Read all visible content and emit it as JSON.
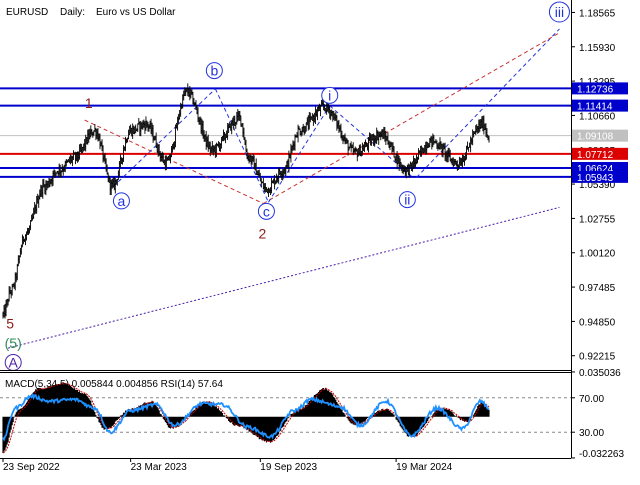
{
  "header": {
    "symbol": "EURUSD",
    "timeframe": "Daily:",
    "description": "Euro vs US Dollar"
  },
  "chart_data": [
    {
      "type": "line",
      "subtype": "candlestick-price",
      "x_ticks": [
        "23 Sep 2022",
        "23 Mar 2023",
        "19 Sep 2023",
        "19 Mar 2024"
      ],
      "y_ticks": [
        "1.18565",
        "1.15930",
        "1.13295",
        "1.10660",
        "1.08025",
        "1.05390",
        "1.02755",
        "1.00120",
        "0.97485",
        "0.94850",
        "0.92215"
      ],
      "ylim": [
        0.9112,
        1.1952
      ],
      "price_anchors": [
        {
          "t": 0,
          "p": 0.9535
        },
        {
          "t": 8,
          "p": 0.972
        },
        {
          "t": 22,
          "p": 1.015
        },
        {
          "t": 40,
          "p": 1.052
        },
        {
          "t": 55,
          "p": 1.065
        },
        {
          "t": 70,
          "p": 1.074
        },
        {
          "t": 90,
          "p": 1.095
        },
        {
          "t": 107,
          "p": 1.052
        },
        {
          "t": 125,
          "p": 1.095
        },
        {
          "t": 140,
          "p": 1.1
        },
        {
          "t": 160,
          "p": 1.07
        },
        {
          "t": 180,
          "p": 1.125
        },
        {
          "t": 205,
          "p": 1.08
        },
        {
          "t": 232,
          "p": 1.105
        },
        {
          "t": 240,
          "p": 1.075
        },
        {
          "t": 258,
          "p": 1.05
        },
        {
          "t": 275,
          "p": 1.065
        },
        {
          "t": 290,
          "p": 1.095
        },
        {
          "t": 315,
          "p": 1.113
        },
        {
          "t": 345,
          "p": 1.078
        },
        {
          "t": 370,
          "p": 1.092
        },
        {
          "t": 395,
          "p": 1.065
        },
        {
          "t": 420,
          "p": 1.087
        },
        {
          "t": 445,
          "p": 1.07
        },
        {
          "t": 470,
          "p": 1.1
        },
        {
          "t": 476,
          "p": 1.09
        }
      ],
      "horizontal_levels": [
        {
          "value": 1.12736,
          "label": "1.12736",
          "color": "#0000cc",
          "label_bg": "#0000cc"
        },
        {
          "value": 1.11414,
          "label": "1.11414",
          "color": "#0000cc",
          "label_bg": "#0000cc"
        },
        {
          "value": 1.09108,
          "label": "1.09108",
          "color": "#c0c0c0",
          "label_bg": "#c0c0c0"
        },
        {
          "value": 1.07712,
          "label": "1.07712",
          "color": "#dd0000",
          "label_bg": "#dd0000"
        },
        {
          "value": 1.06624,
          "label": "1.06624",
          "color": "#0000cc",
          "label_bg": "#0000cc"
        },
        {
          "value": 1.05943,
          "label": "1.05943",
          "color": "#0000cc",
          "label_bg": "#0000cc"
        }
      ],
      "trend_lines": [
        {
          "from": {
            "t": 5,
            "p": 0.928
          },
          "to": {
            "t": 545,
            "p": 1.036
          },
          "color": "#4b1fa8",
          "style": "dotted"
        },
        {
          "from": {
            "t": 405,
            "p": 1.059
          },
          "to": {
            "t": 545,
            "p": 1.173
          },
          "color": "#2233dd",
          "style": "dashed"
        },
        {
          "from": {
            "t": 255,
            "p": 1.039
          },
          "to": {
            "t": 545,
            "p": 1.17
          },
          "color": "#cc3333",
          "style": "dashed"
        },
        {
          "from": {
            "t": 80,
            "p": 1.103
          },
          "to": {
            "t": 255,
            "p": 1.039
          },
          "color": "#cc3333",
          "style": "dashed"
        },
        {
          "from": {
            "t": 108,
            "p": 1.052
          },
          "to": {
            "t": 208,
            "p": 1.127
          },
          "color": "#2233dd",
          "style": "dashed"
        },
        {
          "from": {
            "t": 208,
            "p": 1.127
          },
          "to": {
            "t": 260,
            "p": 1.04
          },
          "color": "#2233dd",
          "style": "dashed"
        },
        {
          "from": {
            "t": 260,
            "p": 1.04
          },
          "to": {
            "t": 320,
            "p": 1.114
          },
          "color": "#2233dd",
          "style": "dashed"
        },
        {
          "from": {
            "t": 320,
            "p": 1.114
          },
          "to": {
            "t": 400,
            "p": 1.06
          },
          "color": "#2233dd",
          "style": "dashed"
        }
      ],
      "wave_labels": [
        {
          "text": "1",
          "t": 84,
          "p": 1.116,
          "color": "#8b1a1a",
          "circled": false
        },
        {
          "text": "2",
          "t": 254,
          "p": 1.016,
          "color": "#8b1a1a",
          "circled": false
        },
        {
          "text": "5",
          "t": 7,
          "p": 0.947,
          "color": "#8b1a1a",
          "circled": false
        },
        {
          "text": "(5)",
          "t": 10,
          "p": 0.932,
          "color": "#2e8b57",
          "circled": false
        },
        {
          "text": "A",
          "t": 10,
          "p": 0.917,
          "color": "#4b1fa8",
          "circled": true
        },
        {
          "text": "a",
          "t": 116,
          "p": 1.041,
          "color": "#2233dd",
          "circled": true
        },
        {
          "text": "b",
          "t": 207,
          "p": 1.141,
          "color": "#2233dd",
          "circled": true
        },
        {
          "text": "c",
          "t": 258,
          "p": 1.033,
          "color": "#2233dd",
          "circled": true
        },
        {
          "text": "i",
          "t": 320,
          "p": 1.122,
          "color": "#2233dd",
          "circled": true
        },
        {
          "text": "ii",
          "t": 396,
          "p": 1.042,
          "color": "#2233dd",
          "circled": true
        },
        {
          "text": "iii",
          "t": 545,
          "p": 1.186,
          "color": "#2233dd",
          "circled": true
        }
      ]
    },
    {
      "type": "line",
      "subtype": "indicator",
      "title": "MACD(5,34,5) 0.005844 0.004856 RSI(14) 57.64",
      "y_ticks": [
        "0.035036",
        "70.00",
        "30.00",
        "-0.032263"
      ],
      "ylim": [
        -0.0323,
        0.035
      ],
      "macd_anchors": [
        {
          "t": 0,
          "v": -0.028
        },
        {
          "t": 15,
          "v": 0.005
        },
        {
          "t": 35,
          "v": 0.022
        },
        {
          "t": 60,
          "v": 0.026
        },
        {
          "t": 80,
          "v": 0.018
        },
        {
          "t": 100,
          "v": -0.01
        },
        {
          "t": 125,
          "v": 0.006
        },
        {
          "t": 145,
          "v": 0.012
        },
        {
          "t": 165,
          "v": -0.009
        },
        {
          "t": 200,
          "v": 0.012
        },
        {
          "t": 230,
          "v": -0.007
        },
        {
          "t": 260,
          "v": -0.02
        },
        {
          "t": 290,
          "v": 0.006
        },
        {
          "t": 315,
          "v": 0.022
        },
        {
          "t": 345,
          "v": -0.006
        },
        {
          "t": 375,
          "v": 0.006
        },
        {
          "t": 400,
          "v": -0.016
        },
        {
          "t": 430,
          "v": 0.007
        },
        {
          "t": 455,
          "v": -0.004
        },
        {
          "t": 470,
          "v": 0.012
        },
        {
          "t": 476,
          "v": 0.0058
        }
      ],
      "rsi_anchors": [
        {
          "t": 0,
          "v": 22
        },
        {
          "t": 12,
          "v": 58
        },
        {
          "t": 28,
          "v": 72
        },
        {
          "t": 45,
          "v": 66
        },
        {
          "t": 70,
          "v": 68
        },
        {
          "t": 90,
          "v": 58
        },
        {
          "t": 105,
          "v": 30
        },
        {
          "t": 125,
          "v": 55
        },
        {
          "t": 150,
          "v": 62
        },
        {
          "t": 168,
          "v": 38
        },
        {
          "t": 195,
          "v": 63
        },
        {
          "t": 215,
          "v": 62
        },
        {
          "t": 240,
          "v": 36
        },
        {
          "t": 262,
          "v": 25
        },
        {
          "t": 285,
          "v": 55
        },
        {
          "t": 302,
          "v": 68
        },
        {
          "t": 330,
          "v": 60
        },
        {
          "t": 350,
          "v": 38
        },
        {
          "t": 375,
          "v": 66
        },
        {
          "t": 400,
          "v": 26
        },
        {
          "t": 425,
          "v": 58
        },
        {
          "t": 450,
          "v": 34
        },
        {
          "t": 468,
          "v": 66
        },
        {
          "t": 476,
          "v": 57.64
        }
      ],
      "colors": {
        "histogram": "#000000",
        "signal": "#cc0000",
        "rsi": "#1e90ff",
        "levels": "#888888"
      }
    }
  ]
}
